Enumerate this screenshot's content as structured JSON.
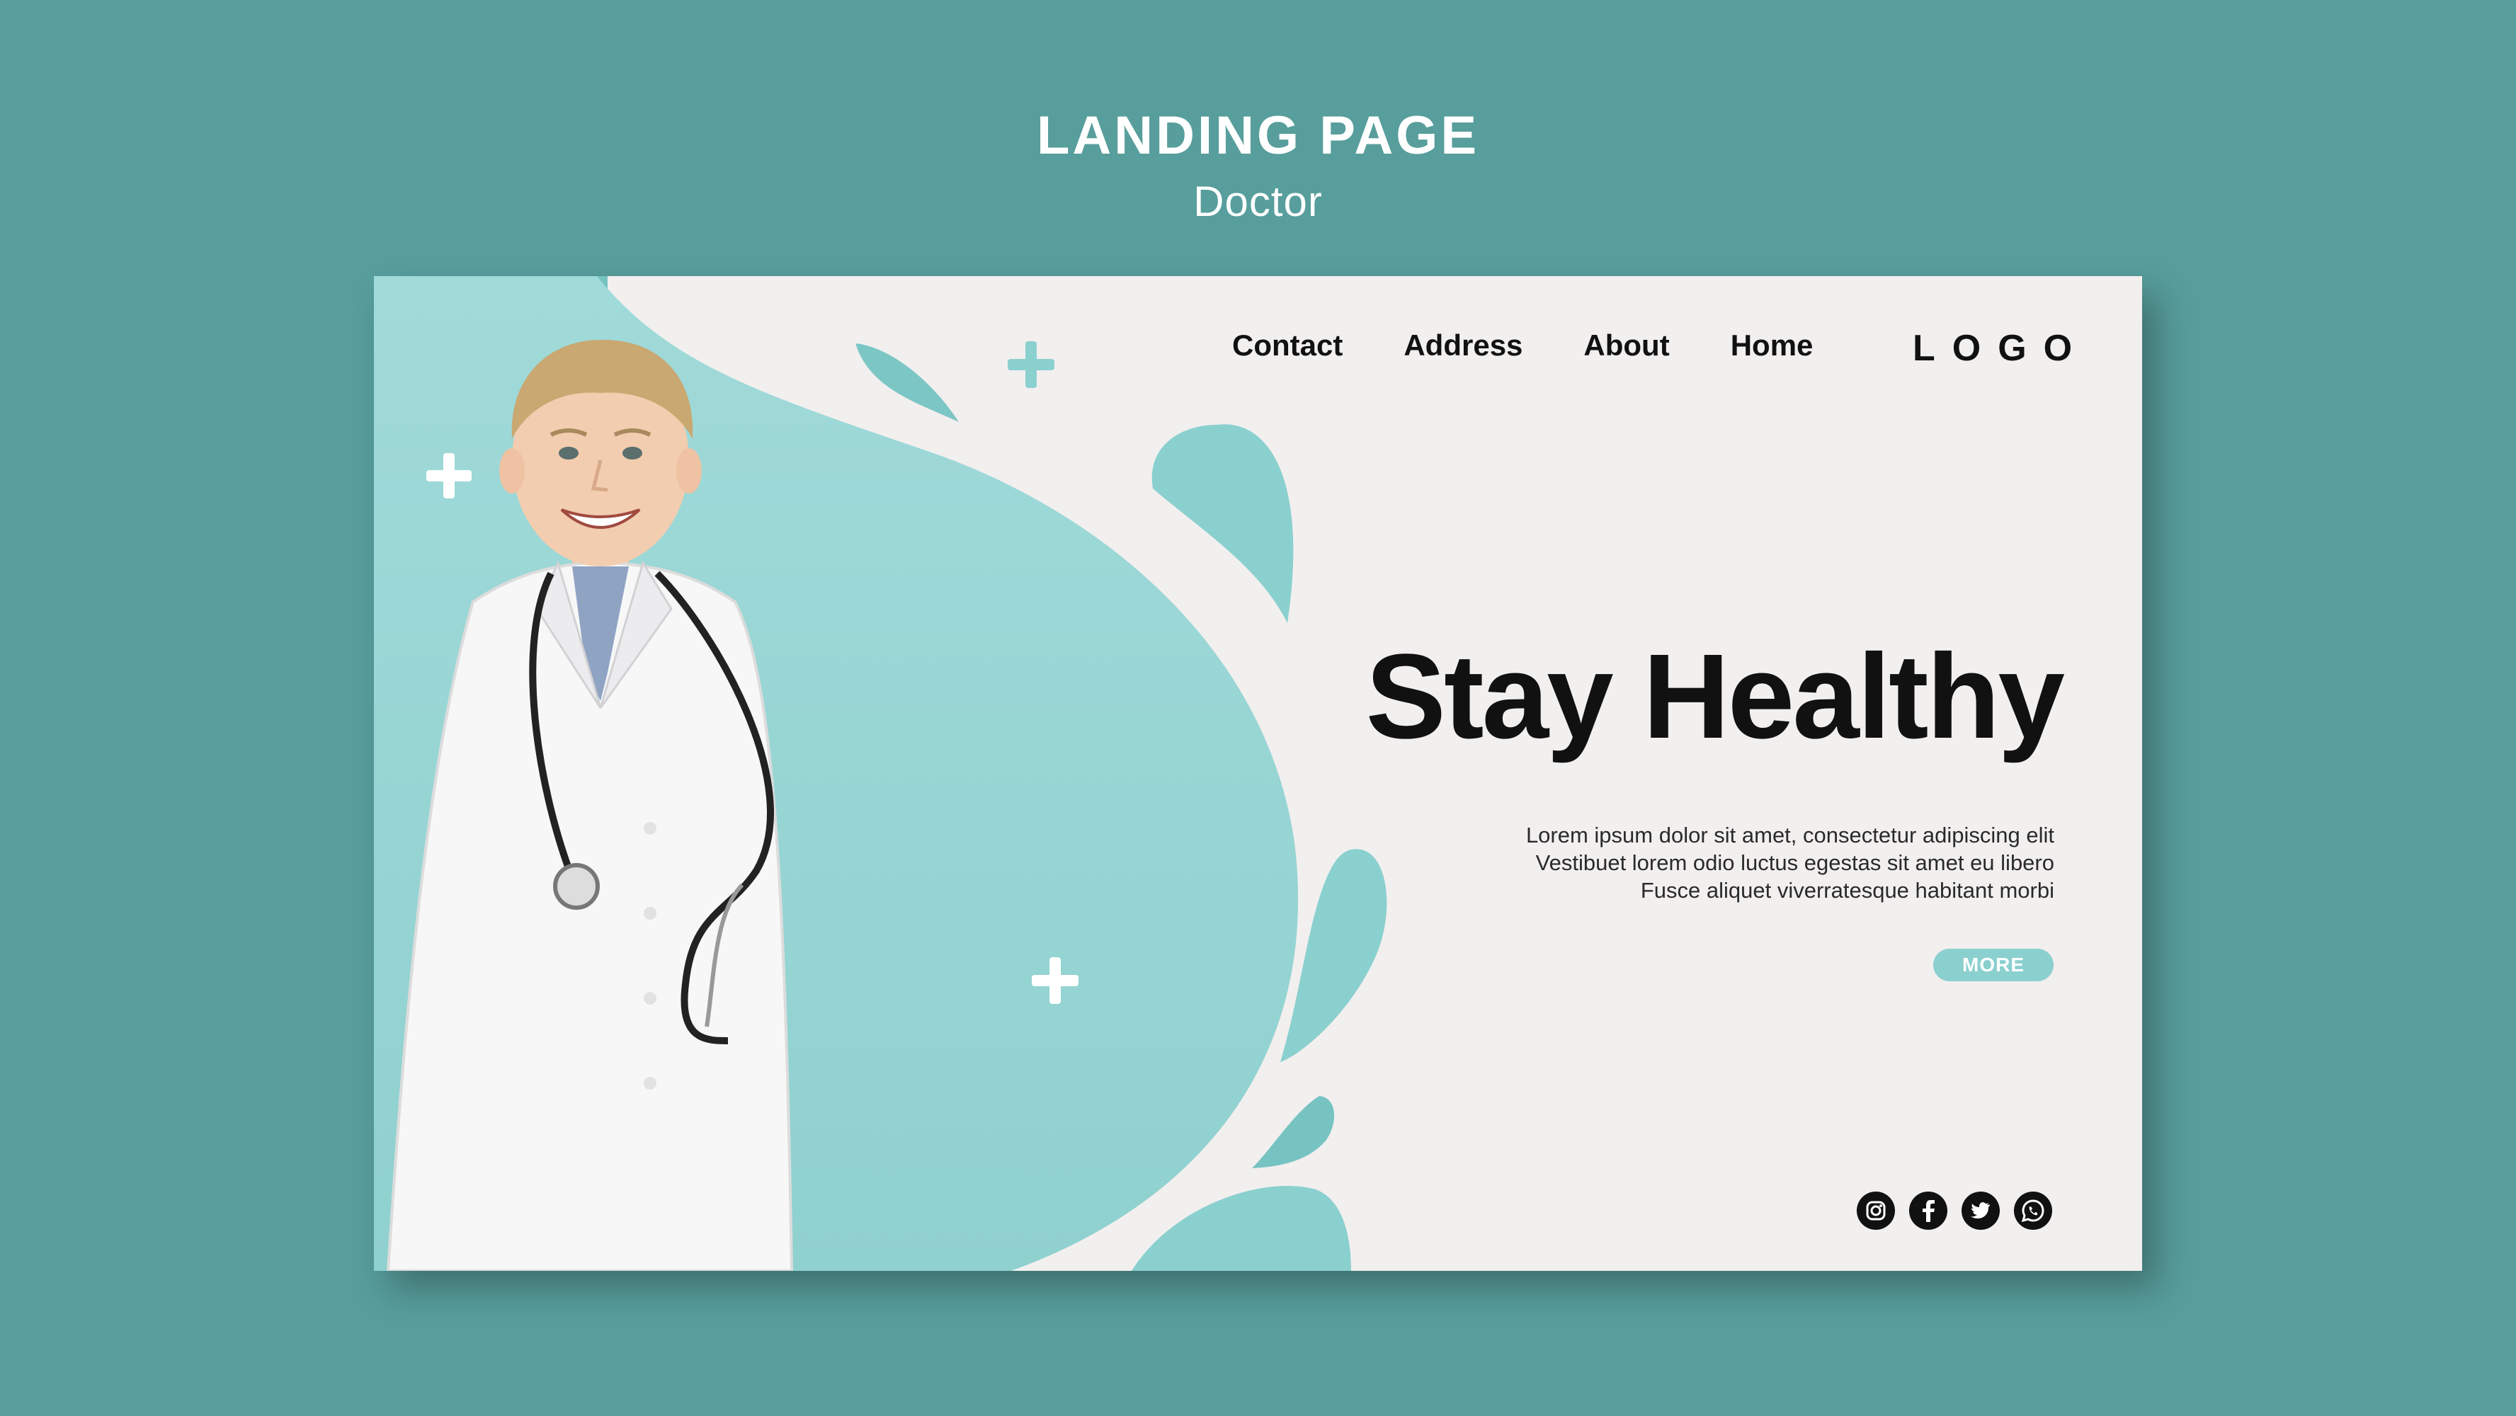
{
  "showcase": {
    "title": "LANDING PAGE",
    "subtitle": "Doctor"
  },
  "nav": {
    "items": [
      {
        "label": "Contact"
      },
      {
        "label": "Address"
      },
      {
        "label": "About"
      },
      {
        "label": "Home"
      }
    ]
  },
  "logo": {
    "text": "LOGO"
  },
  "hero": {
    "title": "Stay Healthy",
    "lines": [
      "Lorem ipsum dolor sit amet, consectetur adipiscing elit",
      "Vestibuet lorem odio luctus egestas sit amet eu libero",
      "Fusce aliquet viverratesque habitant morbi"
    ],
    "button_label": "MORE",
    "image_subject": "smiling child in white doctor coat with stethoscope"
  },
  "social": [
    "instagram-icon",
    "facebook-icon",
    "twitter-icon",
    "whatsapp-icon"
  ],
  "colors": {
    "background": "#579e9c",
    "card": "#f2efef",
    "accent": "#8ad0cf",
    "accent_dark": "#63b9b8",
    "text": "#111111"
  }
}
